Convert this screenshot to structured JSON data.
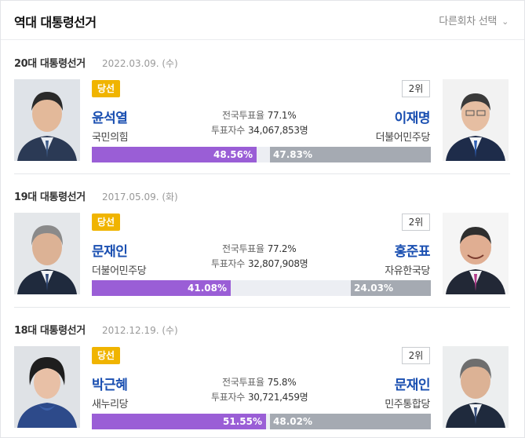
{
  "header": {
    "title": "역대 대통령선거",
    "select_label": "다른회차 선택",
    "select_icon": "chevron-down-icon"
  },
  "colors": {
    "winner_badge": "#f0b400",
    "winner_bar": "#9a5ed6",
    "loser_bar": "#a5aab2",
    "name": "#1a4fb1"
  },
  "elections": [
    {
      "title": "20대 대통령선거",
      "date": "2022.03.09. (수)",
      "winner_badge": "당선",
      "rank_badge": "2위",
      "winner": {
        "name": "윤석열",
        "party": "국민의힘",
        "percent": 48.56,
        "percent_label": "48.56%"
      },
      "runnerup": {
        "name": "이재명",
        "party": "더불어민주당",
        "percent": 47.83,
        "percent_label": "47.83%"
      },
      "turnout_label": "전국투표율",
      "turnout": "77.1%",
      "voters_label": "투표자수",
      "voters": "34,067,853명"
    },
    {
      "title": "19대 대통령선거",
      "date": "2017.05.09. (화)",
      "winner_badge": "당선",
      "rank_badge": "2위",
      "winner": {
        "name": "문재인",
        "party": "더불어민주당",
        "percent": 41.08,
        "percent_label": "41.08%"
      },
      "runnerup": {
        "name": "홍준표",
        "party": "자유한국당",
        "percent": 24.03,
        "percent_label": "24.03%"
      },
      "turnout_label": "전국투표율",
      "turnout": "77.2%",
      "voters_label": "투표자수",
      "voters": "32,807,908명"
    },
    {
      "title": "18대 대통령선거",
      "date": "2012.12.19. (수)",
      "winner_badge": "당선",
      "rank_badge": "2위",
      "winner": {
        "name": "박근혜",
        "party": "새누리당",
        "percent": 51.55,
        "percent_label": "51.55%"
      },
      "runnerup": {
        "name": "문재인",
        "party": "민주통합당",
        "percent": 48.02,
        "percent_label": "48.02%"
      },
      "turnout_label": "전국투표율",
      "turnout": "75.8%",
      "voters_label": "투표자수",
      "voters": "30,721,459명"
    }
  ]
}
